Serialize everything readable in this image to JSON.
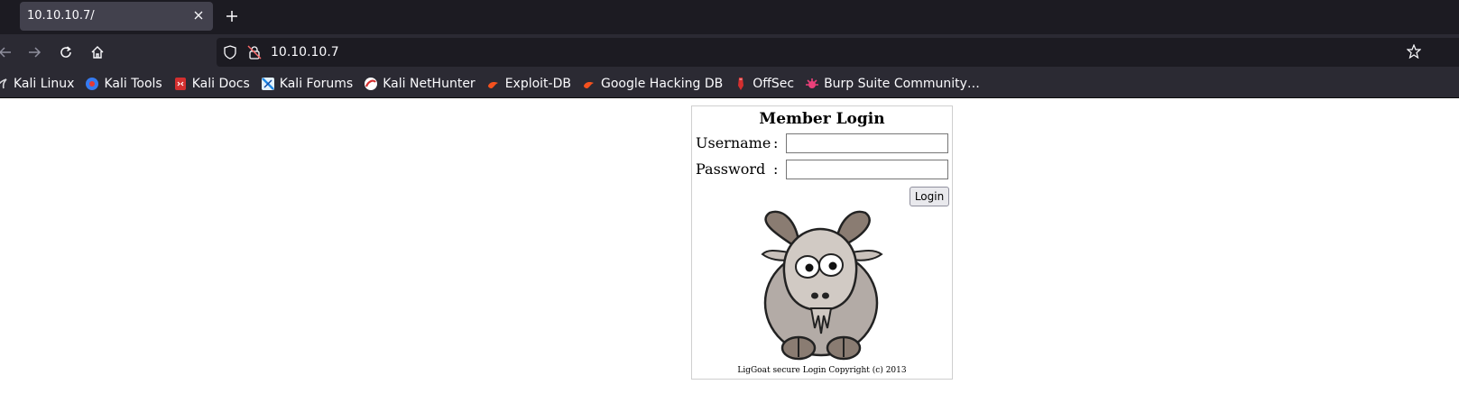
{
  "browser": {
    "tab": {
      "title": "10.10.10.7/"
    },
    "url": "10.10.10.7",
    "bookmarks": [
      {
        "label": "Kali Linux",
        "icon": "kali-dragon-icon"
      },
      {
        "label": "Kali Tools",
        "icon": "kali-tools-icon"
      },
      {
        "label": "Kali Docs",
        "icon": "kali-docs-icon"
      },
      {
        "label": "Kali Forums",
        "icon": "kali-forums-icon"
      },
      {
        "label": "Kali NetHunter",
        "icon": "nethunter-icon"
      },
      {
        "label": "Exploit-DB",
        "icon": "exploit-db-icon"
      },
      {
        "label": "Google Hacking DB",
        "icon": "ghdb-icon"
      },
      {
        "label": "OffSec",
        "icon": "offsec-icon"
      },
      {
        "label": "Burp Suite Community…",
        "icon": "burp-icon"
      }
    ]
  },
  "login": {
    "title": "Member Login",
    "username_label": "Username",
    "password_label": "Password",
    "colon": ":",
    "username_value": "",
    "password_value": "",
    "button_label": "Login",
    "footer": "LigGoat secure Login Copyright (c) 2013"
  },
  "colors": {
    "tabstrip": "#1c1b22",
    "toolbar": "#2b2a33",
    "tab_active": "#42414d"
  }
}
